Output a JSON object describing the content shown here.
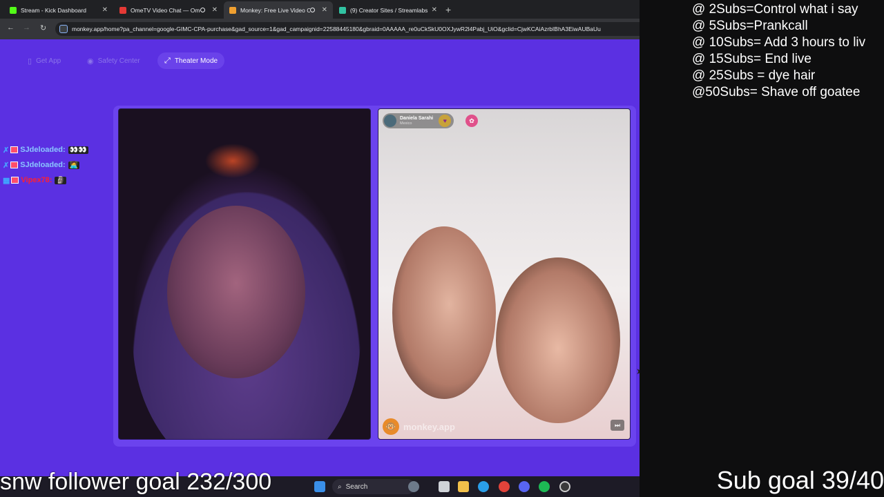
{
  "browser": {
    "tabs": [
      {
        "title": "Stream - Kick Dashboard",
        "icon": "kick-icon",
        "color": "#53fc18",
        "active": false,
        "recording": false
      },
      {
        "title": "OmeTV Video Chat — Ome",
        "icon": "ometv-icon",
        "color": "#e53935",
        "active": false,
        "recording": true
      },
      {
        "title": "Monkey: Free Live Video Ch",
        "icon": "monkey-icon",
        "color": "#f0a030",
        "active": true,
        "recording": true
      },
      {
        "title": "(9) Creator Sites / Streamlabs",
        "icon": "streamlabs-icon",
        "color": "#31c3a2",
        "active": false,
        "recording": false
      }
    ],
    "url": "monkey.app/home?pa_channel=google-GIMC-CPA-purchase&gad_source=1&gad_campaignid=22588445180&gbraid=0AAAAA_re0uCkSkU0OXJywR2l4Pabj_UiO&gclid=CjwKCAiAzrbIBhA3EiwAUBaUu"
  },
  "site": {
    "buttons": {
      "get_app": "Get App",
      "safety_center": "Safety Center",
      "theater_mode": "Theater Mode"
    },
    "partner": {
      "name": "Daniela Sarahi",
      "country": "Mexico"
    },
    "brand": "monkey.app"
  },
  "chat": [
    {
      "user": "SJdeloaded:",
      "color": "#8ac6ff",
      "emote": "👀👀"
    },
    {
      "user": "SJdeloaded:",
      "color": "#8ac6ff",
      "emote": "🧑‍💻"
    },
    {
      "user": "Vipex78:",
      "color": "#ff2030",
      "emote": "🗿"
    }
  ],
  "overlay": {
    "rules": [
      "@ 2Subs=Control what i say",
      "@ 5Subs=Prankcall",
      "@ 10Subs= Add 3 hours to liv",
      "@ 15Subs= End live",
      "@ 25Subs = dye hair",
      "@50Subs=  Shave off goatee"
    ],
    "follower_goal": "snw follower goal 232/300",
    "sub_goal": "Sub goal 39/40"
  },
  "taskbar": {
    "search_label": "Search"
  }
}
